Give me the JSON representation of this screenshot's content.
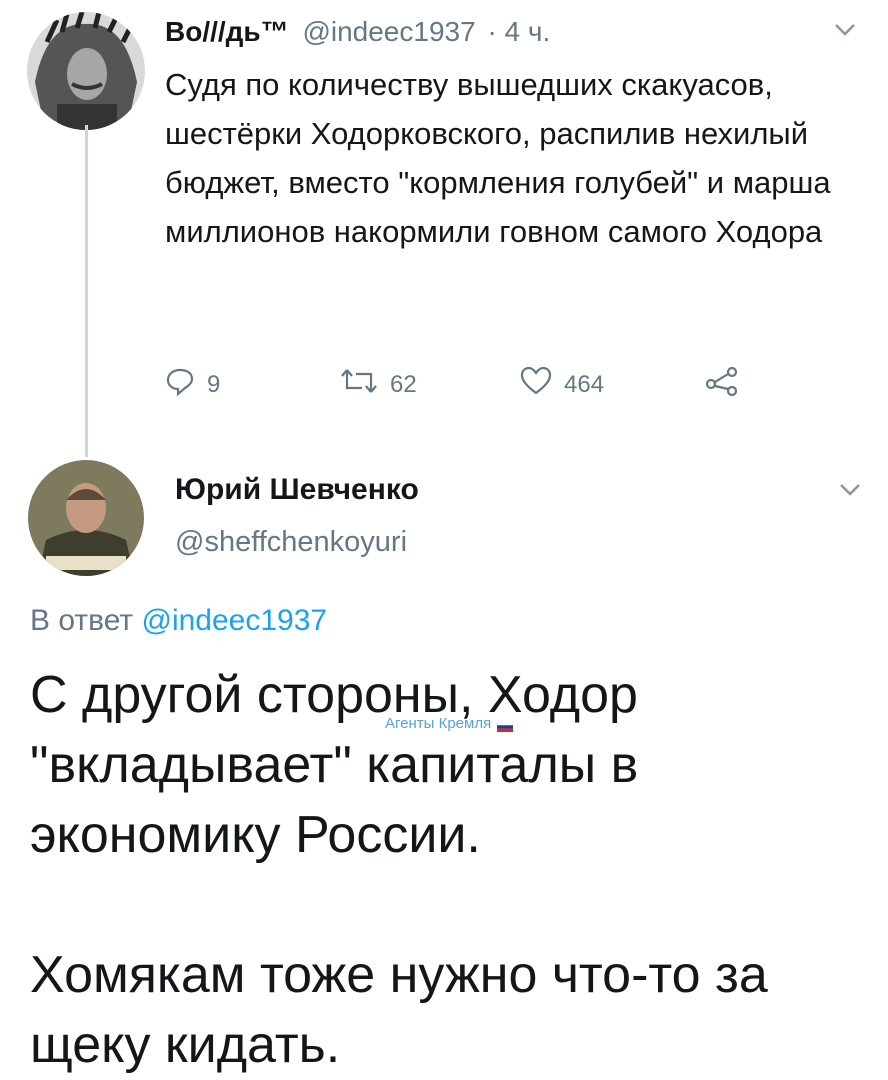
{
  "tweet1": {
    "display_name": "Во///дь™",
    "handle": "@indeec1937",
    "time": "· 4 ч.",
    "text": "Судя по количеству вышедших скакуасов, шестёрки Ходорковского, распилив нехилый бюджет, вместо \"кормления голубей\" и марша миллионов накормили говном самого Ходора",
    "actions": {
      "replies": "9",
      "retweets": "62",
      "likes": "464"
    }
  },
  "tweet2": {
    "display_name": "Юрий Шевченко",
    "handle": "@sheffchenkoyuri",
    "reply_prefix": "В ответ ",
    "reply_to": "@indeec1937",
    "text": "С другой стороны, Ходор \"вкладывает\" капиталы в экономику России.\n\nХомякам тоже нужно что-то за щеку кидать."
  },
  "watermark": {
    "text": "Агенты Кремля"
  },
  "icons": {
    "reply": "reply-icon",
    "retweet": "retweet-icon",
    "like": "heart-icon",
    "share": "share-icon",
    "more": "chevron-down-icon"
  },
  "colors": {
    "link": "#1da1f2",
    "muted": "#657786",
    "text": "#14171a",
    "thread": "#ccd6dd"
  }
}
